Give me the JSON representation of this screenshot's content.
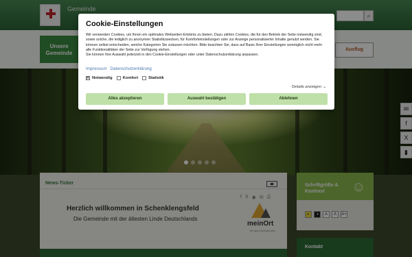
{
  "header": {
    "brand_line": "Gemeinde",
    "search_button": "⌕"
  },
  "nav": {
    "item1": "Unsere Gemeinde",
    "partner_logo": "Ausflug"
  },
  "news": {
    "ticker_label": "News-Ticker",
    "welcome_title": "Herzlich willkommen in Schenklengsfeld",
    "welcome_subtitle": "Die Gemeinde mit der ältesten Linde Deutschlands",
    "meinort_word": "meinOrt",
    "meinort_tag": "Ihr App-Lieferservice"
  },
  "sidebar": {
    "a11y_title": "Schriftgröße & Kontrast",
    "kontakt_label": "Kontakt",
    "a11y_buttons": [
      "◐",
      "◑",
      "A",
      "A",
      "A+"
    ]
  },
  "social": [
    "✉",
    "f",
    "X",
    "▮"
  ],
  "cookie": {
    "title": "Cookie-Einstellungen",
    "body": "Wir verwenden Cookies, um Ihnen ein optimales Webseiten-Erlebnis zu bieten. Dazu zählen Cookies, die für den Betrieb der Seite notwendig sind, sowie solche, die lediglich zu anonymen Statistikzwecken, für Komforteinstellungen oder zur Anzeige personalisierter Inhalte genutzt werden. Sie können selbst entscheiden, welche Kategorien Sie zulassen möchten. Bitte beachten Sie, dass auf Basis Ihrer Einstellungen womöglich nicht mehr alle Funktionalitäten der Seite zur Verfügung stehen.",
    "body2": "Sie können Ihre Auswahl jederzeit in den Cookie-Einstellungen oder unter Datenschutzerklärung anpassen.",
    "link_impressum": "Impressum",
    "link_datenschutz": "Datenschutzerklärung",
    "check_notwendig": "Notwendig",
    "check_komfort": "Komfort",
    "check_statistik": "Statistik",
    "details": "Details anzeigen",
    "btn_accept_all": "Alles akzeptieren",
    "btn_confirm": "Auswahl bestätigen",
    "btn_reject": "Ablehnen"
  }
}
